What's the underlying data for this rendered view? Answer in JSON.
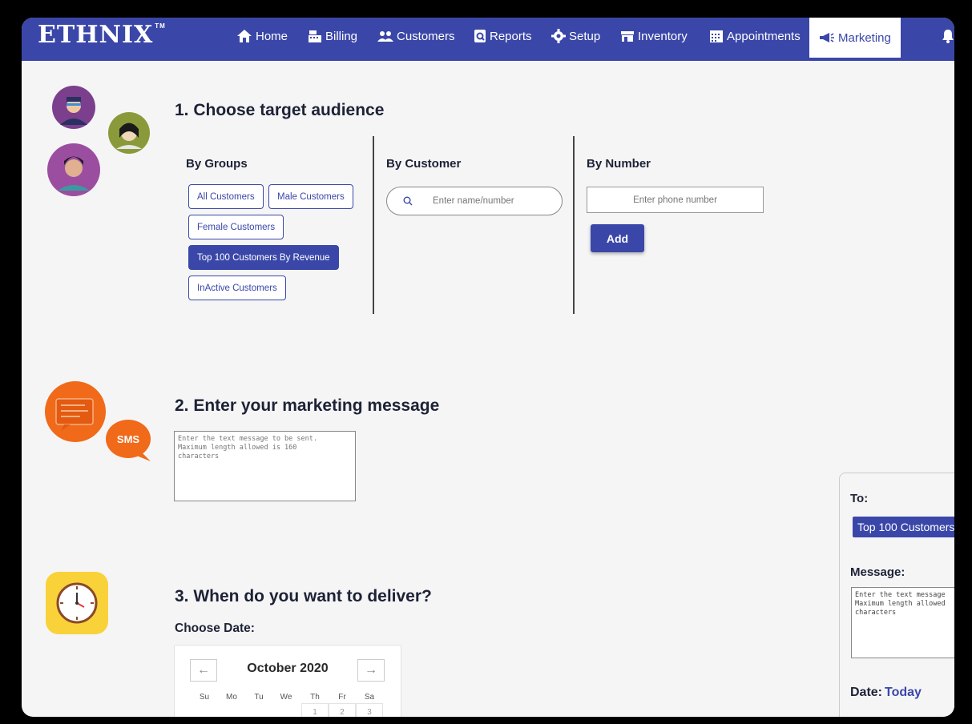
{
  "app": {
    "logo": "ETHNIX",
    "logo_tm": "TM"
  },
  "nav": {
    "items": [
      {
        "label": "Home",
        "icon": "home-icon"
      },
      {
        "label": "Billing",
        "icon": "cash-register-icon"
      },
      {
        "label": "Customers",
        "icon": "users-icon"
      },
      {
        "label": "Reports",
        "icon": "reports-icon"
      },
      {
        "label": "Setup",
        "icon": "gear-icon"
      },
      {
        "label": "Inventory",
        "icon": "store-icon"
      },
      {
        "label": "Appointments",
        "icon": "calendar-icon"
      },
      {
        "label": "Marketing",
        "icon": "megaphone-icon",
        "active": true
      }
    ]
  },
  "step1": {
    "title": "1. Choose target audience",
    "by_groups": {
      "title": "By Groups",
      "chips": [
        {
          "label": "All Customers",
          "selected": false
        },
        {
          "label": "Male Customers",
          "selected": false
        },
        {
          "label": "Female Customers",
          "selected": false
        },
        {
          "label": "Top 100 Customers By Revenue",
          "selected": true
        },
        {
          "label": "InActive Customers",
          "selected": false
        }
      ]
    },
    "by_customer": {
      "title": "By Customer",
      "placeholder": "Enter name/number"
    },
    "by_number": {
      "title": "By Number",
      "placeholder": "Enter phone number",
      "add_label": "Add"
    }
  },
  "step2": {
    "title": "2. Enter your marketing message",
    "sms_badge": "SMS",
    "placeholder": "Enter the text message to be sent.\nMaximum length allowed is 160\ncharacters"
  },
  "step3": {
    "title": "3. When do you want to deliver?",
    "choose_date_label": "Choose Date:",
    "calendar": {
      "month": "October 2020",
      "weekdays": [
        "Su",
        "Mo",
        "Tu",
        "We",
        "Th",
        "Fr",
        "Sa"
      ],
      "first_days": [
        "1",
        "2",
        "3"
      ]
    }
  },
  "preview": {
    "to_label": "To:",
    "to_value": "Top 100 Customers",
    "message_label": "Message:",
    "message_text": "Enter the text message\nMaximum length allowed\ncharacters",
    "date_label": "Date:",
    "date_value": "Today"
  },
  "colors": {
    "accent": "#3a47a8",
    "background": "#f5f5f6"
  }
}
